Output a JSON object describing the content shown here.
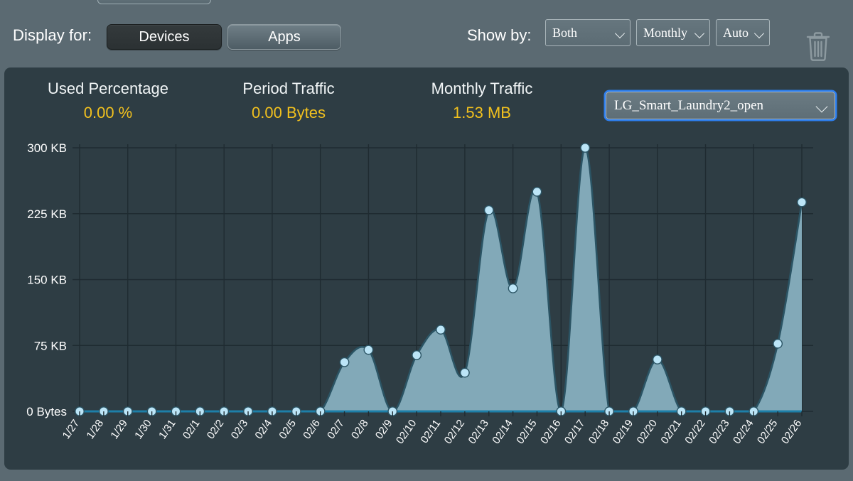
{
  "toolbar": {
    "display_label": "Display for:",
    "devices_button": "Devices",
    "apps_button": "Apps",
    "show_by_label": "Show by:",
    "selects": [
      {
        "name": "traffic-direction",
        "value": "Both"
      },
      {
        "name": "period",
        "value": "Monthly"
      },
      {
        "name": "scale",
        "value": "Auto"
      }
    ],
    "trash_icon": "trash-icon"
  },
  "stats": [
    {
      "title": "Used Percentage",
      "value": "0.00 %"
    },
    {
      "title": "Period Traffic",
      "value": "0.00 Bytes"
    },
    {
      "title": "Monthly Traffic",
      "value": "1.53 MB"
    }
  ],
  "device_select": {
    "value": "LG_Smart_Laundry2_open",
    "chevron_icon": "chevron-down-icon"
  },
  "colors": {
    "page_background": "#5b6a72",
    "panel_background": "#2e3d44",
    "accent_value": "#f2c11e",
    "area_fill": "#82a9b8",
    "line_stroke": "#2b5464",
    "marker_fill": "#bce5f7",
    "grid": "#1f2b31",
    "focus_ring": "#2d7ff0"
  },
  "chart_data": {
    "type": "area",
    "title": "",
    "xlabel": "",
    "ylabel": "",
    "ylim": [
      0,
      300
    ],
    "yunit": "KB",
    "grid": true,
    "legend": "none",
    "ytick_labels": [
      "0 Bytes",
      "75 KB",
      "150 KB",
      "225 KB",
      "300 KB"
    ],
    "ytick_values": [
      0,
      75,
      150,
      225,
      300
    ],
    "categories": [
      "1/27",
      "1/28",
      "1/29",
      "1/30",
      "1/31",
      "02/1",
      "02/2",
      "02/3",
      "02/4",
      "02/5",
      "02/6",
      "02/7",
      "02/8",
      "02/9",
      "02/10",
      "02/11",
      "02/12",
      "02/13",
      "02/14",
      "02/15",
      "02/16",
      "02/17",
      "02/18",
      "02/19",
      "02/20",
      "02/21",
      "02/22",
      "02/23",
      "02/24",
      "02/25",
      "02/26"
    ],
    "values": [
      0,
      0,
      0,
      0,
      0,
      0,
      0,
      0,
      0,
      0,
      0,
      56,
      70,
      0,
      64,
      93,
      44,
      229,
      140,
      250,
      0,
      300,
      0,
      0,
      59,
      0,
      0,
      0,
      0,
      77,
      238
    ]
  }
}
